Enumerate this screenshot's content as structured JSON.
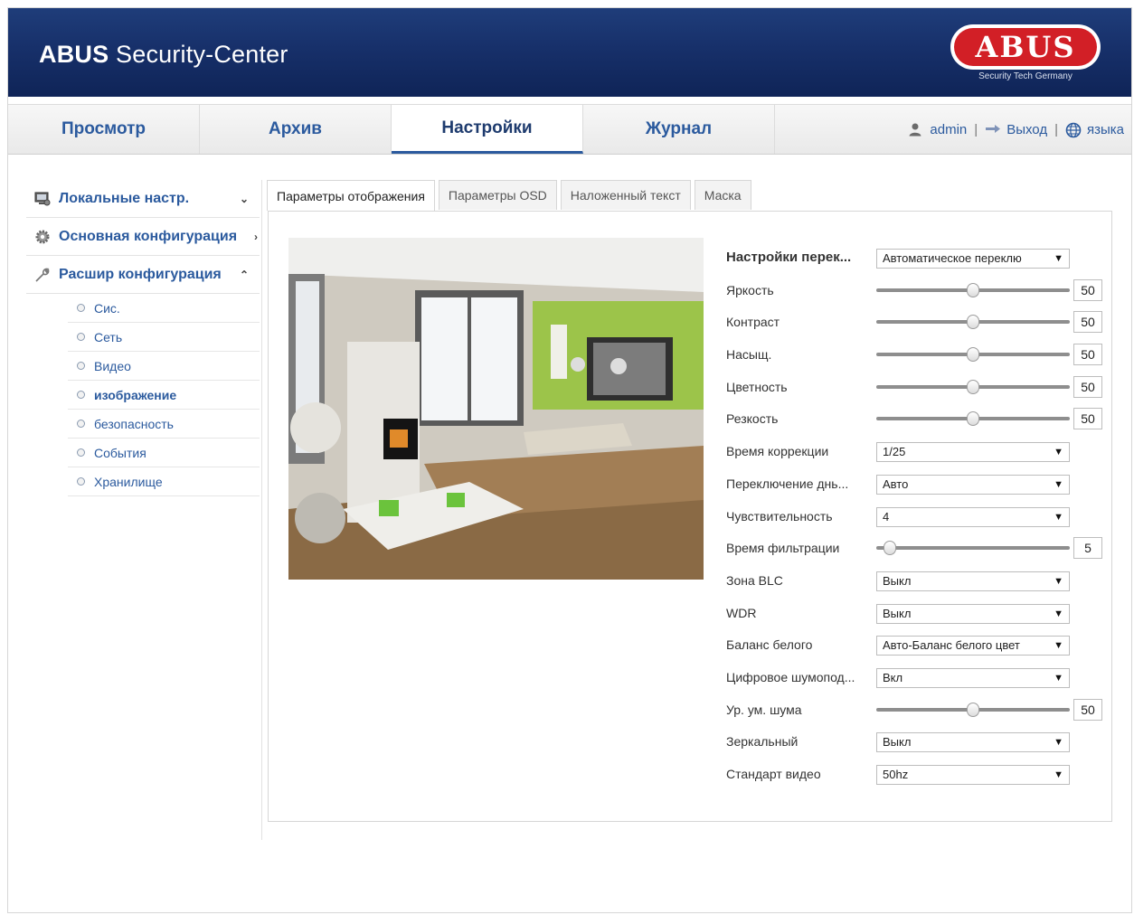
{
  "header": {
    "title_bold": "ABUS",
    "title_rest": " Security-Center",
    "logo_text": "ABUS",
    "logo_tagline": "Security Tech Germany",
    "colors": {
      "header_bg": "#17306a",
      "logo_red": "#d21f26",
      "link_blue": "#2b5a9e"
    }
  },
  "nav": {
    "tabs": [
      {
        "label": "Просмотр"
      },
      {
        "label": "Архив"
      },
      {
        "label": "Настройки",
        "active": true
      },
      {
        "label": "Журнал"
      }
    ],
    "user": {
      "name": "admin",
      "logout": "Выход",
      "language": "языка",
      "separator": "|"
    }
  },
  "sidebar": {
    "sections": [
      {
        "label": "Локальные настр.",
        "icon": "monitor-icon",
        "arrow": "⌄"
      },
      {
        "label": "Основная конфигурация",
        "icon": "gear-icon",
        "arrow": "›"
      },
      {
        "label": "Расшир конфигурация",
        "icon": "wrench-icon",
        "arrow": "⌃"
      }
    ],
    "items": [
      {
        "label": "Сис."
      },
      {
        "label": "Сеть"
      },
      {
        "label": "Видео"
      },
      {
        "label": "изображение",
        "active": true
      },
      {
        "label": "безопасность"
      },
      {
        "label": "События"
      },
      {
        "label": "Хранилище"
      }
    ]
  },
  "content": {
    "tabs": [
      {
        "label": "Параметры отображения",
        "active": true
      },
      {
        "label": "Параметры OSD"
      },
      {
        "label": "Наложенный текст"
      },
      {
        "label": "Маска"
      }
    ]
  },
  "settings": [
    {
      "label": "Настройки перек...",
      "type": "select",
      "value": "Автоматическое переклю",
      "bold": true
    },
    {
      "label": "Яркость",
      "type": "slider",
      "value": "50",
      "max": 100
    },
    {
      "label": "Контраст",
      "type": "slider",
      "value": "50",
      "max": 100
    },
    {
      "label": "Насыщ.",
      "type": "slider",
      "value": "50",
      "max": 100
    },
    {
      "label": "Цветность",
      "type": "slider",
      "value": "50",
      "max": 100
    },
    {
      "label": "Резкость",
      "type": "slider",
      "value": "50",
      "max": 100
    },
    {
      "label": "Время коррекции",
      "type": "select",
      "value": "1/25"
    },
    {
      "label": "Переключение днь...",
      "type": "select",
      "value": "Авто"
    },
    {
      "label": "Чувствительность",
      "type": "select",
      "value": "4"
    },
    {
      "label": "Время фильтрации",
      "type": "slider",
      "value": "5",
      "max": 120
    },
    {
      "label": "Зона BLC",
      "type": "select",
      "value": "Выкл"
    },
    {
      "label": "WDR",
      "type": "select",
      "value": "Выкл"
    },
    {
      "label": "Баланс белого",
      "type": "select",
      "value": "Авто-Баланс белого цвет"
    },
    {
      "label": "Цифровое шумопод...",
      "type": "select",
      "value": "Вкл"
    },
    {
      "label": "Ур. ум. шума",
      "type": "slider",
      "value": "50",
      "max": 100
    },
    {
      "label": "Зеркальный",
      "type": "select",
      "value": "Выкл"
    },
    {
      "label": "Стандарт видео",
      "type": "select",
      "value": "50hz"
    }
  ]
}
